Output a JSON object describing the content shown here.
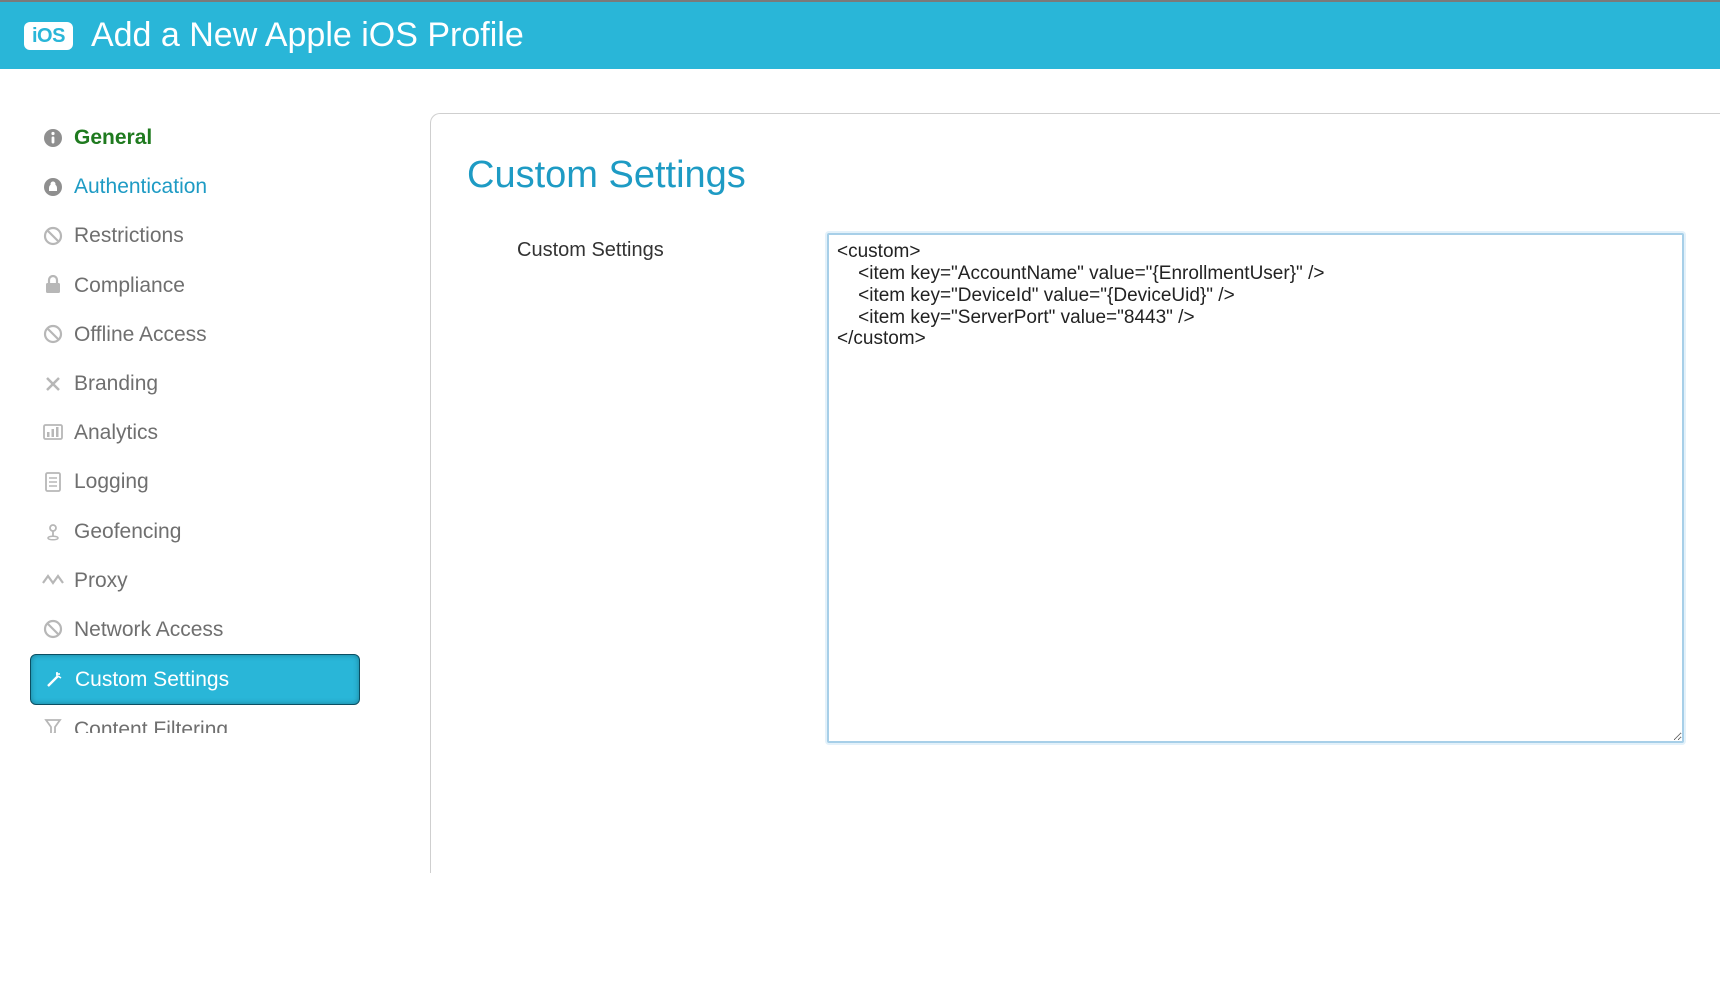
{
  "header": {
    "ios_badge": "iOS",
    "title": "Add a New Apple iOS Profile"
  },
  "sidebar": {
    "items": [
      {
        "label": "General"
      },
      {
        "label": "Authentication"
      },
      {
        "label": "Restrictions"
      },
      {
        "label": "Compliance"
      },
      {
        "label": "Offline Access"
      },
      {
        "label": "Branding"
      },
      {
        "label": "Analytics"
      },
      {
        "label": "Logging"
      },
      {
        "label": "Geofencing"
      },
      {
        "label": "Proxy"
      },
      {
        "label": "Network Access"
      },
      {
        "label": "Custom Settings"
      },
      {
        "label": "Content Filtering"
      }
    ]
  },
  "main": {
    "section_title": "Custom Settings",
    "field_label": "Custom Settings",
    "field_value": "<custom>\n    <item key=\"AccountName\" value=\"{EnrollmentUser}\" />\n    <item key=\"DeviceId\" value=\"{DeviceUid}\" />\n    <item key=\"ServerPort\" value=\"8443\" />\n</custom>"
  }
}
